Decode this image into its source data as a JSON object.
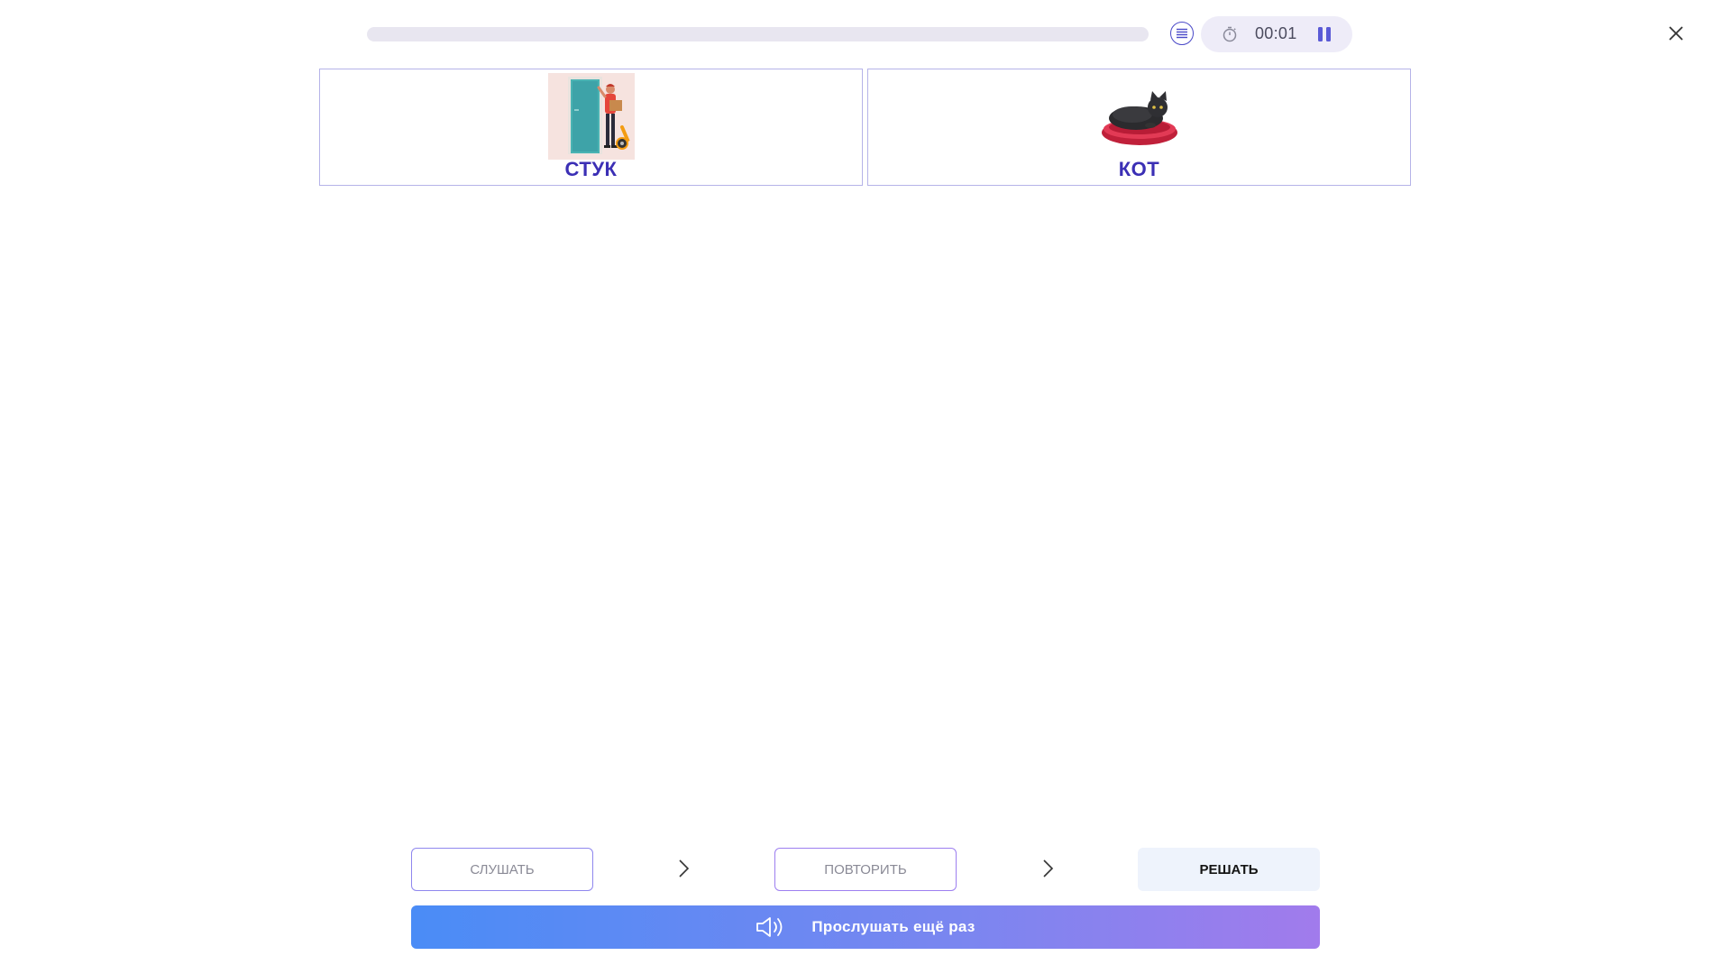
{
  "header": {
    "progress_percent": 0,
    "timer": "00:01",
    "icons": {
      "list": "list-icon",
      "timer": "stopwatch-icon",
      "pause": "pause-icon",
      "close": "close-icon"
    }
  },
  "cards": [
    {
      "label": "СТУК",
      "image": "door-knock-illustration"
    },
    {
      "label": "КОТ",
      "image": "cat-in-bed-illustration"
    }
  ],
  "steps": {
    "listen": "СЛУШАТЬ",
    "repeat": "ПОВТОРИТЬ",
    "solve": "РЕШАТЬ"
  },
  "play_again": {
    "label": "Прослушать ещё раз",
    "icon": "speaker-icon"
  },
  "colors": {
    "accent": "#3b2fb5",
    "card_border": "#b5b3e8",
    "gradient_start": "#4a8cf6",
    "gradient_end": "#a17bec"
  }
}
